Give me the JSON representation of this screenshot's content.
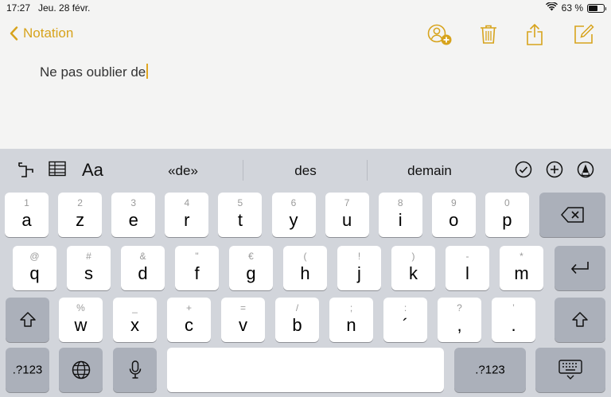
{
  "status": {
    "time": "17:27",
    "date": "Jeu. 28 févr.",
    "battery": "63 %",
    "battery_level": 0.63
  },
  "nav": {
    "back_label": "Notation"
  },
  "note": {
    "text": "Ne pas oublier de"
  },
  "predictions": [
    "«de»",
    "des",
    "demain"
  ],
  "keys": {
    "row1": [
      {
        "sub": "1",
        "main": "a"
      },
      {
        "sub": "2",
        "main": "z"
      },
      {
        "sub": "3",
        "main": "e"
      },
      {
        "sub": "4",
        "main": "r"
      },
      {
        "sub": "5",
        "main": "t"
      },
      {
        "sub": "6",
        "main": "y"
      },
      {
        "sub": "7",
        "main": "u"
      },
      {
        "sub": "8",
        "main": "i"
      },
      {
        "sub": "9",
        "main": "o"
      },
      {
        "sub": "0",
        "main": "p"
      }
    ],
    "row2": [
      {
        "sub": "@",
        "main": "q"
      },
      {
        "sub": "#",
        "main": "s"
      },
      {
        "sub": "&",
        "main": "d"
      },
      {
        "sub": "\"",
        "main": "f"
      },
      {
        "sub": "€",
        "main": "g"
      },
      {
        "sub": "(",
        "main": "h"
      },
      {
        "sub": "!",
        "main": "j"
      },
      {
        "sub": ")",
        "main": "k"
      },
      {
        "sub": "-",
        "main": "l"
      },
      {
        "sub": "*",
        "main": "m"
      }
    ],
    "row3": [
      {
        "sub": "%",
        "main": "w"
      },
      {
        "sub": "_",
        "main": "x"
      },
      {
        "sub": "+",
        "main": "c"
      },
      {
        "sub": "=",
        "main": "v"
      },
      {
        "sub": "/",
        "main": "b"
      },
      {
        "sub": ";",
        "main": "n"
      },
      {
        "sub": ":",
        "main": "´"
      },
      {
        "sub": "?",
        "main": ","
      },
      {
        "sub": "’",
        "main": "."
      }
    ],
    "numbers_label_left": ".?123",
    "numbers_label_right": ".?123"
  },
  "colors": {
    "accent": "#d7a31c",
    "keyboard_bg": "#d2d5db",
    "dark_key": "#abb0ba"
  }
}
